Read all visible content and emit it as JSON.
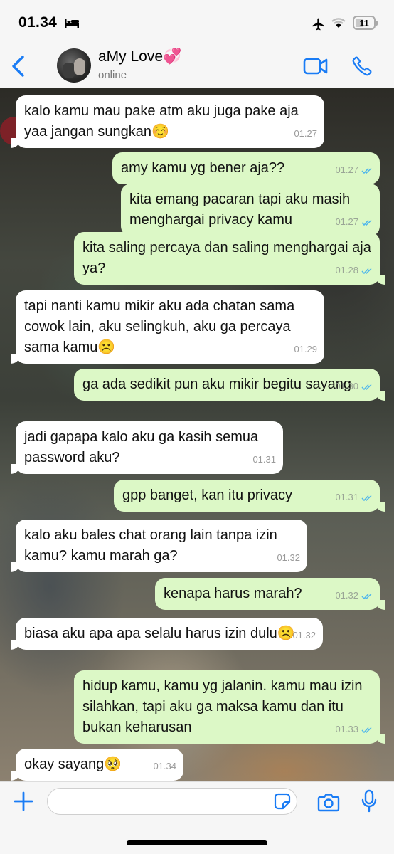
{
  "status": {
    "time": "01.34",
    "battery": "11"
  },
  "header": {
    "contact_name": "aMy Love💞",
    "status": "online"
  },
  "messages": [
    {
      "dir": "in",
      "text": "kalo kamu mau pake atm aku juga pake aja yaa jangan sungkan☺️",
      "time": "01.27"
    },
    {
      "dir": "out",
      "text": "amy kamu yg bener aja??",
      "time": "01.27"
    },
    {
      "dir": "out",
      "text": "kita emang pacaran tapi aku masih menghargai privacy kamu",
      "time": "01.27"
    },
    {
      "dir": "out",
      "text": "kita saling percaya dan saling menghargai aja ya?",
      "time": "01.28"
    },
    {
      "dir": "in",
      "text": "tapi nanti kamu mikir aku ada chatan sama cowok lain, aku selingkuh, aku ga percaya sama kamu☹️",
      "time": "01.29"
    },
    {
      "dir": "out",
      "text": "ga ada sedikit pun aku mikir begitu sayang",
      "time": "01.30"
    },
    {
      "dir": "in",
      "text": "jadi gapapa kalo aku ga kasih semua password aku?",
      "time": "01.31"
    },
    {
      "dir": "out",
      "text": "gpp banget, kan itu privacy",
      "time": "01.31"
    },
    {
      "dir": "in",
      "text": "kalo aku bales chat orang lain tanpa izin kamu? kamu marah ga?",
      "time": "01.32"
    },
    {
      "dir": "out",
      "text": "kenapa harus marah?",
      "time": "01.32"
    },
    {
      "dir": "in",
      "text": "biasa aku apa apa selalu harus izin dulu☹️",
      "time": "01.32"
    },
    {
      "dir": "out",
      "text": "hidup kamu, kamu yg jalanin. kamu mau izin silahkan, tapi aku ga maksa kamu dan itu bukan keharusan",
      "time": "01.33"
    },
    {
      "dir": "in",
      "text": "okay sayang🥺",
      "time": "01.34"
    }
  ],
  "composer": {
    "value": ""
  },
  "colors": {
    "accent": "#1a7cf5",
    "outgoing": "#dcf8c6",
    "incoming": "#ffffff",
    "read_ticks": "#4fb6ec"
  }
}
